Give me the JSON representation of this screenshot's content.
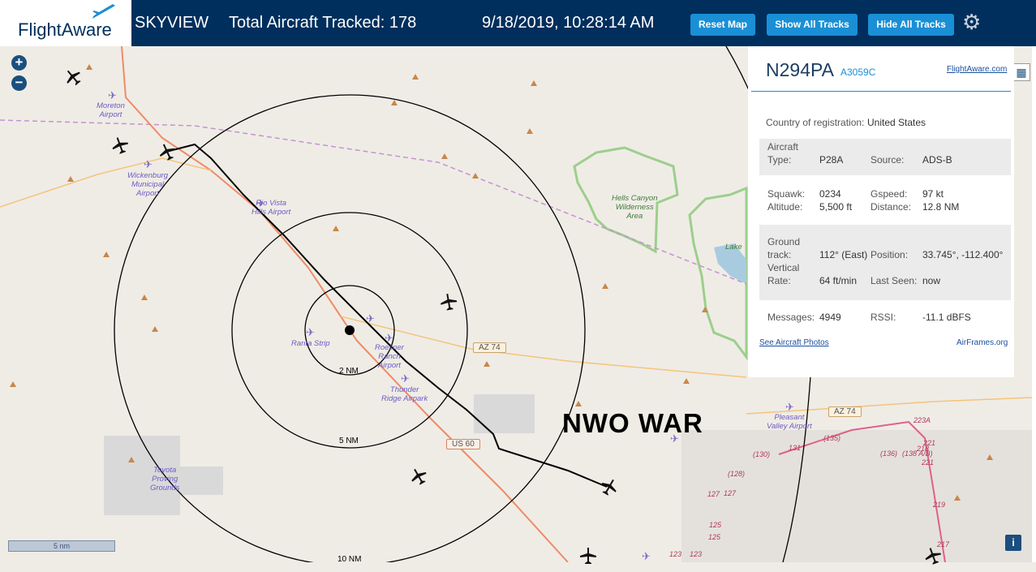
{
  "header": {
    "logo_text": "FlightAware",
    "app_name": "SKYVIEW",
    "total_tracked": "Total Aircraft Tracked: 178",
    "datetime": "9/18/2019, 10:28:14 AM",
    "buttons": {
      "reset": "Reset Map",
      "show_all": "Show All Tracks",
      "hide_all": "Hide All Tracks"
    }
  },
  "zoom": {
    "in": "+",
    "out": "−"
  },
  "map": {
    "rings": [
      "2 NM",
      "5 NM",
      "10 NM"
    ],
    "scale_label": "5 nm",
    "overlay_text": "NWO WAR",
    "roads": [
      "AZ 74",
      "US 60",
      "AZ 74"
    ],
    "places": [
      {
        "name": "Moreton\nAirport"
      },
      {
        "name": "Wickenburg\nMunicipal\nAirport"
      },
      {
        "name": "Rio Vista\nHills Airport"
      },
      {
        "name": "Ranta Strip"
      },
      {
        "name": "Roesner\nRanch\nAirport"
      },
      {
        "name": "Thunder\nRidge Airpark"
      },
      {
        "name": "Hells Canyon\nWilderness\nArea"
      },
      {
        "name": "Toyota\nProving\nGrounds"
      },
      {
        "name": "Pleasant\nValley Airport"
      },
      {
        "name": "Lake"
      }
    ],
    "highway_numbers": [
      "(135)",
      "(130)",
      "131",
      "(136)",
      "(138 A/B)",
      "221",
      "223A",
      "218",
      "219",
      "221",
      "(128)",
      "127",
      "127",
      "125",
      "125",
      "123",
      "123",
      "217"
    ]
  },
  "panel": {
    "registration": "N294PA",
    "hex": "A3059C",
    "flightaware_link": "FlightAware.com",
    "country_label": "Country of registration:",
    "country_value": "United States",
    "aircraft_type_label": "Aircraft\nType:",
    "aircraft_type_value": "P28A",
    "source_label": "Source:",
    "source_value": "ADS-B",
    "squawk_label": "Squawk:",
    "squawk_value": "0234",
    "gspeed_label": "Gspeed:",
    "gspeed_value": "97 kt",
    "altitude_label": "Altitude:",
    "altitude_value": "5,500 ft",
    "distance_label": "Distance:",
    "distance_value": "12.8 NM",
    "ground_track_label": "Ground\ntrack:",
    "ground_track_value": "112° (East)",
    "position_label": "Position:",
    "position_value": "33.745°, -112.400°",
    "vertical_rate_label": "Vertical\nRate:",
    "vertical_rate_value": "64 ft/min",
    "last_seen_label": "Last Seen:",
    "last_seen_value": "now",
    "messages_label": "Messages:",
    "messages_value": "4949",
    "rssi_label": "RSSI:",
    "rssi_value": "-11.1 dBFS",
    "photos_link": "See Aircraft Photos",
    "airframes_link": "AirFrames.org"
  },
  "icons": {
    "settings": "gear-icon",
    "grid": "grid-icon",
    "info": "info-icon",
    "plane": "plane-icon"
  },
  "colors": {
    "header_bg": "#002f5d",
    "button": "#1a8fd6",
    "map_bg": "#efece6",
    "track": "#000000"
  }
}
